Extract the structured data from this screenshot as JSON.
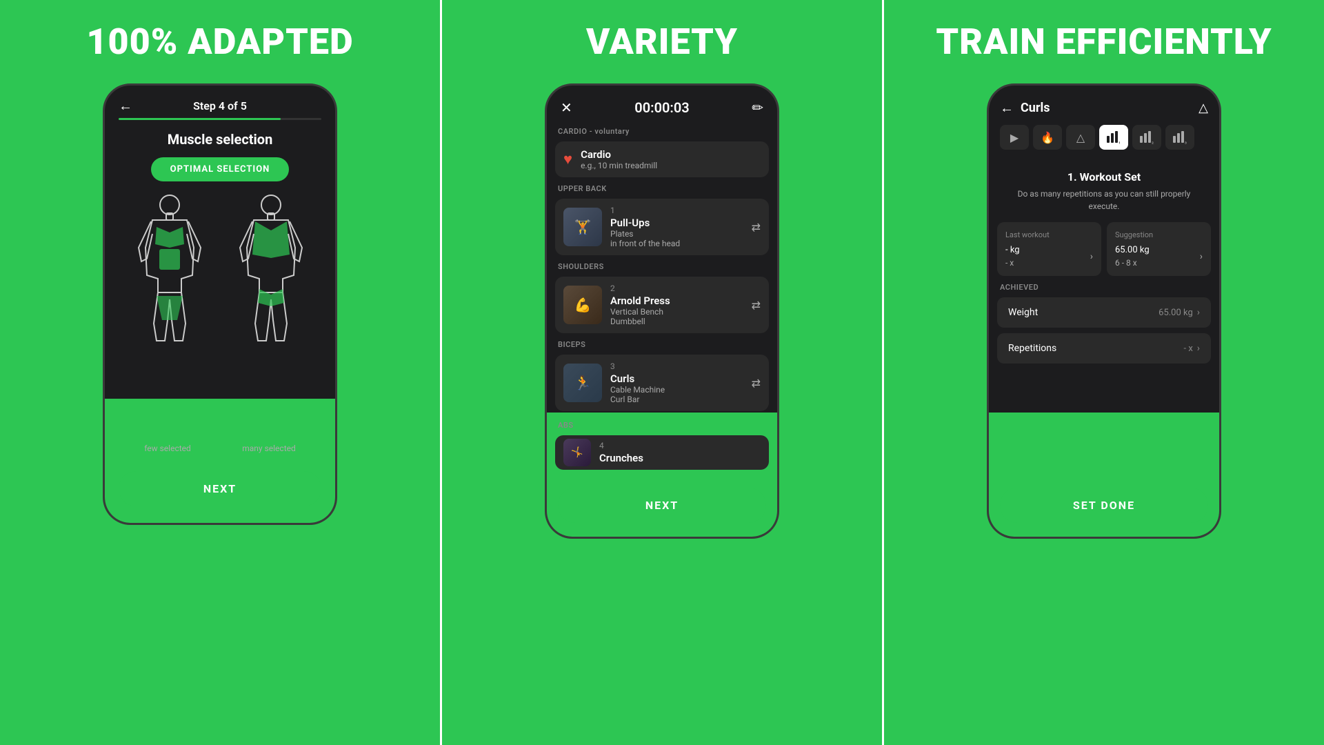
{
  "panel1": {
    "heading": "100% ADAPTED",
    "phone": {
      "header": {
        "back_icon": "←",
        "title": "Step 4 of 5",
        "progress_pct": 80
      },
      "muscle_selection": {
        "title": "Muscle selection",
        "optimal_button": "OPTIMAL SELECTION"
      },
      "labels": {
        "few": "few selected",
        "many": "many selected"
      },
      "next_button": "NEXT"
    }
  },
  "panel2": {
    "heading": "VARIETY",
    "phone": {
      "header": {
        "close_icon": "✕",
        "timer": "00:00:03",
        "edit_icon": "✏"
      },
      "sections": [
        {
          "label": "CARDIO - voluntary",
          "exercises": [
            {
              "num": "",
              "name": "Cardio",
              "sub1": "e.g., 10 min treadmill",
              "sub2": "",
              "has_swap": false,
              "is_cardio": true
            }
          ]
        },
        {
          "label": "UPPER BACK",
          "exercises": [
            {
              "num": "1",
              "name": "Pull-Ups",
              "sub1": "Plates",
              "sub2": "in front of the head",
              "has_swap": true,
              "thumb_type": "pullups"
            }
          ]
        },
        {
          "label": "SHOULDERS",
          "exercises": [
            {
              "num": "2",
              "name": "Arnold Press",
              "sub1": "Vertical Bench",
              "sub2": "Dumbbell",
              "has_swap": true,
              "thumb_type": "arnold"
            }
          ]
        },
        {
          "label": "BICEPS",
          "exercises": [
            {
              "num": "3",
              "name": "Curls",
              "sub1": "Cable Machine",
              "sub2": "Curl Bar",
              "has_swap": true,
              "thumb_type": "curls"
            }
          ]
        },
        {
          "label": "ABS",
          "exercises": [
            {
              "num": "4",
              "name": "Crunches",
              "sub1": "",
              "sub2": "",
              "has_swap": false,
              "thumb_type": "crunches",
              "partial": true
            }
          ]
        }
      ],
      "next_button": "NEXT"
    }
  },
  "panel3": {
    "heading": "TRAIN EFFICIENTLY",
    "phone": {
      "header": {
        "back_icon": "←",
        "title": "Curls",
        "triangle_icon": "△"
      },
      "tabs": [
        {
          "icon": "▶",
          "active": false
        },
        {
          "icon": "🔥",
          "active": false
        },
        {
          "icon": "△",
          "active": false
        },
        {
          "icon": "⊣₁",
          "active": true
        },
        {
          "icon": "⊣₂",
          "active": false
        },
        {
          "icon": "⊣₃",
          "active": false
        }
      ],
      "workout_set": {
        "title": "1. Workout Set",
        "description": "Do as many repetitions as you can still properly execute."
      },
      "stats": {
        "last_workout": {
          "label": "Last workout",
          "weight": "- kg",
          "reps": "- x"
        },
        "suggestion": {
          "label": "Suggestion",
          "weight": "65.00 kg",
          "reps": "6 - 8 x"
        }
      },
      "achieved_label": "ACHIEVED",
      "achieved": [
        {
          "name": "Weight",
          "value": "65.00 kg"
        },
        {
          "name": "Repetitions",
          "value": "- x"
        }
      ],
      "set_done_button": "SET DONE"
    }
  }
}
